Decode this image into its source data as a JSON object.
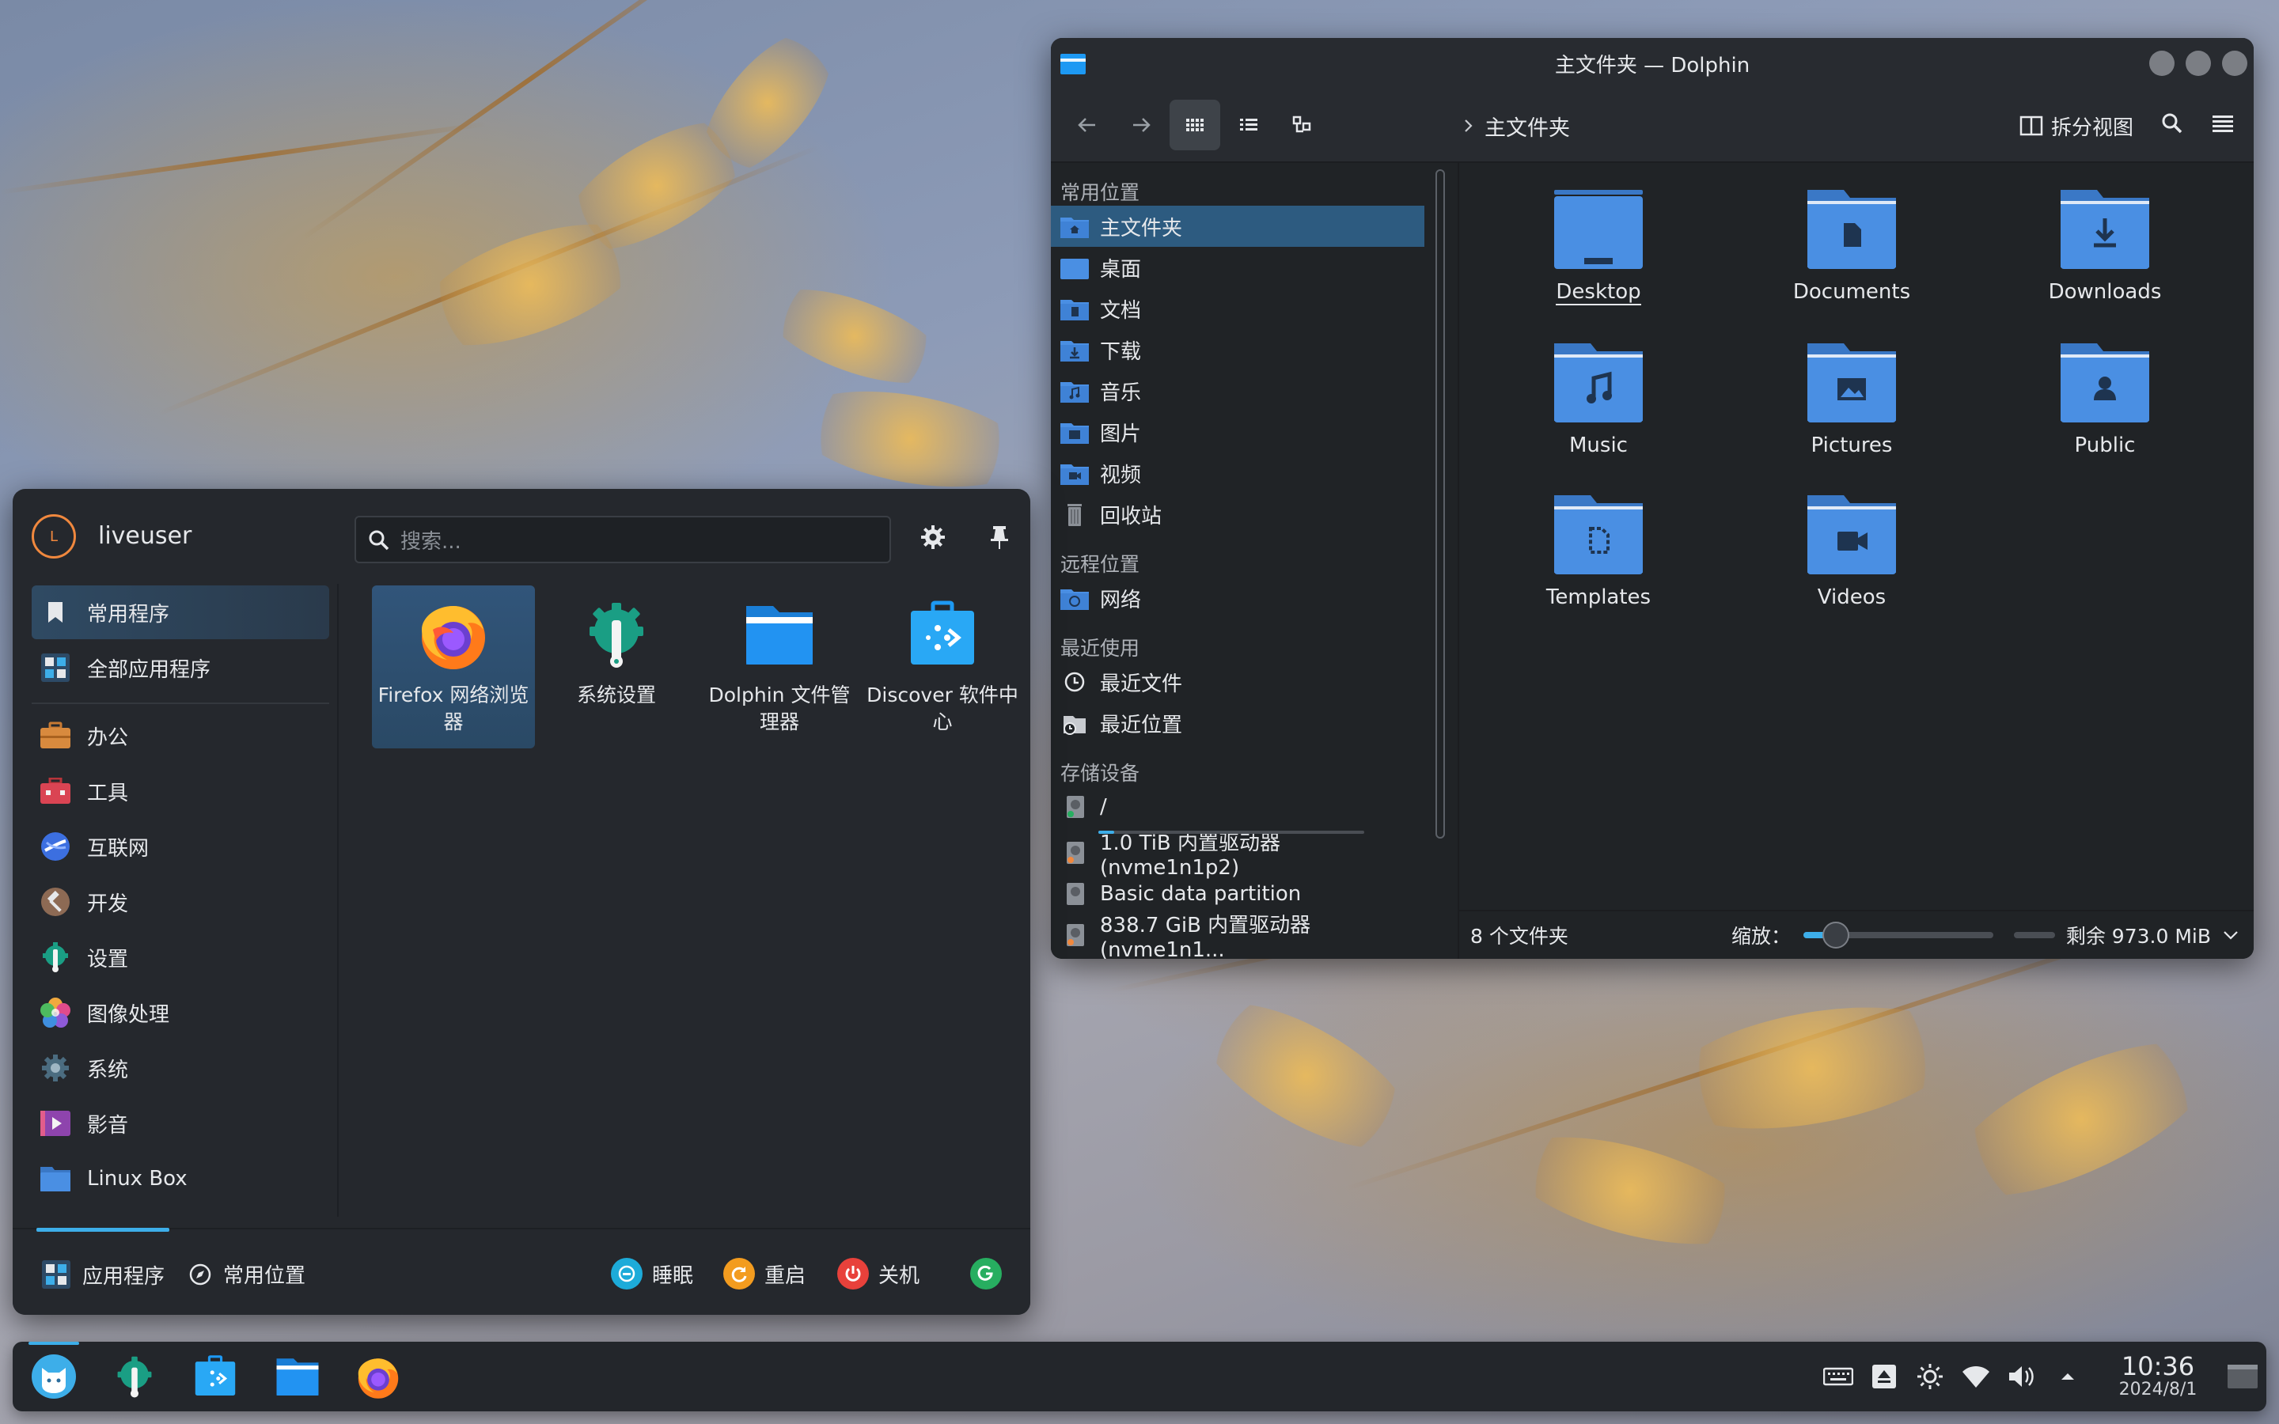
{
  "dolphin": {
    "title": "主文件夹 — Dolphin",
    "breadcrumb": "主文件夹",
    "split_view_label": "拆分视图",
    "places": {
      "group_common": "常用位置",
      "common": [
        "主文件夹",
        "桌面",
        "文档",
        "下载",
        "音乐",
        "图片",
        "视频",
        "回收站"
      ],
      "group_remote": "远程位置",
      "remote": [
        "网络"
      ],
      "group_recent": "最近使用",
      "recent": [
        "最近文件",
        "最近位置"
      ],
      "group_storage": "存储设备",
      "storage": [
        "/",
        "1.0 TiB 内置驱动器 (nvme1n1p2)",
        "Basic data partition",
        "838.7 GiB 内置驱动器 (nvme1n1..."
      ]
    },
    "folders": [
      "Desktop",
      "Documents",
      "Downloads",
      "Music",
      "Pictures",
      "Public",
      "Templates",
      "Videos"
    ],
    "status_count": "8 个文件夹",
    "zoom_label": "缩放：",
    "free_space": "剩余 973.0 MiB"
  },
  "launcher": {
    "username": "liveuser",
    "avatar_letter": "L",
    "search_placeholder": "搜索...",
    "categories": [
      "常用程序",
      "全部应用程序",
      "办公",
      "工具",
      "互联网",
      "开发",
      "设置",
      "图像处理",
      "系统",
      "影音",
      "Linux Box"
    ],
    "apps": [
      "Firefox 网络浏览器",
      "系统设置",
      "Dolphin 文件管理器",
      "Discover 软件中心"
    ],
    "footer_tabs": [
      "应用程序",
      "常用位置"
    ],
    "power": [
      "睡眠",
      "重启",
      "关机"
    ]
  },
  "taskbar": {
    "time": "10:36",
    "date": "2024/8/1"
  },
  "colors": {
    "accent": "#3daee9",
    "folder_blue": "#4a8fe3",
    "selection": "#2d5b80"
  }
}
